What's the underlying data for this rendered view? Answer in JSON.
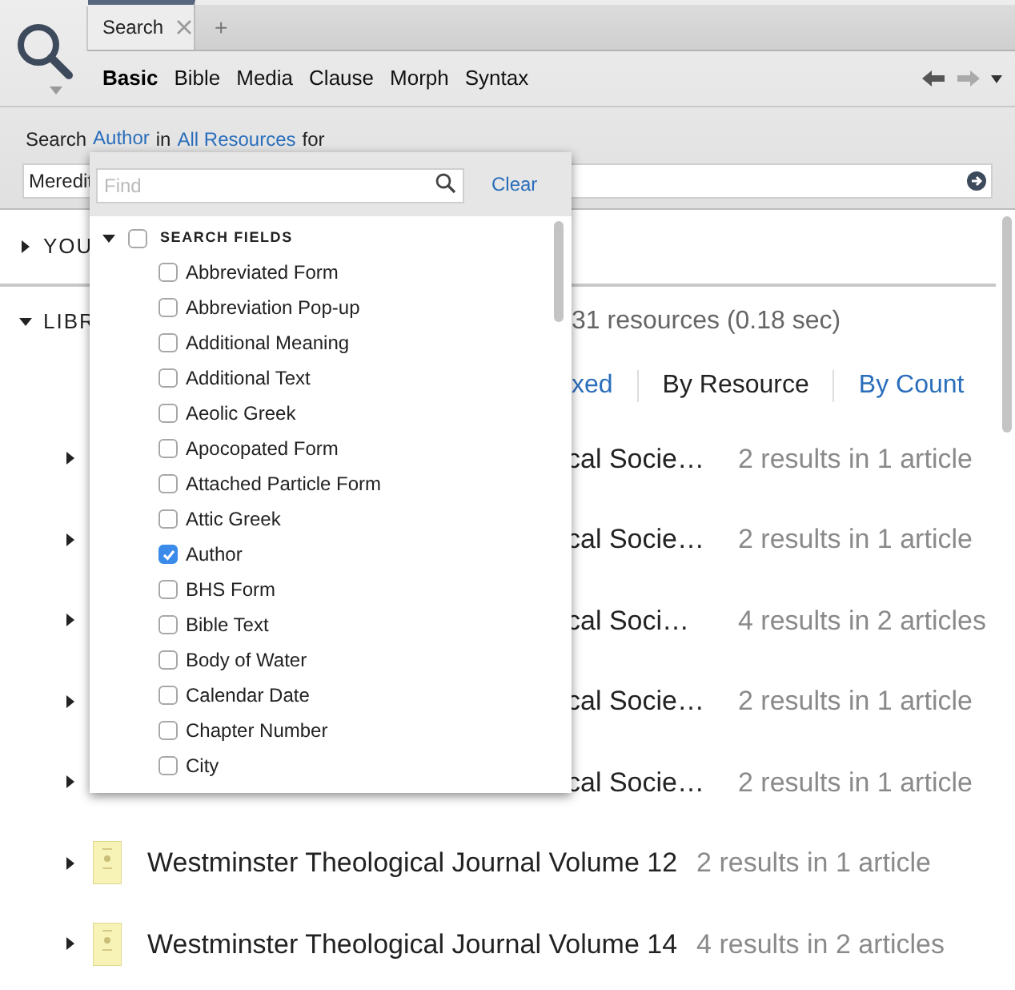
{
  "tabs": [
    {
      "label": "Search",
      "selected": true
    }
  ],
  "new_tab": "+",
  "search_types": [
    {
      "label": "Basic",
      "selected": true
    },
    {
      "label": "Bible",
      "selected": false
    },
    {
      "label": "Media",
      "selected": false
    },
    {
      "label": "Clause",
      "selected": false
    },
    {
      "label": "Morph",
      "selected": false
    },
    {
      "label": "Syntax",
      "selected": false
    }
  ],
  "query": {
    "prefix": "Search",
    "field": "Author",
    "connector": "in",
    "scope": "All Resources",
    "suffix": "for",
    "value": "Meredit"
  },
  "sections": [
    {
      "label": "YOU",
      "expanded": false
    },
    {
      "label": "LIBR",
      "expanded": true
    }
  ],
  "summary": "31 resources (0.18 sec)",
  "view_tabs": [
    {
      "label": "xed",
      "selected": false
    },
    {
      "label": "By Resource",
      "selected": true
    },
    {
      "label": "By Count",
      "selected": false
    }
  ],
  "results": [
    {
      "kind": "covered",
      "title": "cal Socie…",
      "count": "2 results in 1 article"
    },
    {
      "kind": "covered",
      "title": "cal Socie…",
      "count": "2 results in 1 article"
    },
    {
      "kind": "covered",
      "title": "cal Soci…",
      "count": "4 results in 2 articles"
    },
    {
      "kind": "covered",
      "title": "cal Socie…",
      "count": "2 results in 1 article"
    },
    {
      "kind": "covered",
      "title": "cal Socie…",
      "count": "2 results in 1 article"
    },
    {
      "kind": "full",
      "title": "Westminster Theological Journal Volume 12",
      "count": "2 results in 1 article"
    },
    {
      "kind": "full",
      "title": "Westminster Theological Journal Volume 14",
      "count": "4 results in 2 articles"
    }
  ],
  "field_picker": {
    "placeholder": "Find",
    "clear": "Clear",
    "group": {
      "label": "SEARCH FIELDS",
      "expanded": true,
      "checked": false,
      "children": [
        {
          "label": "Abbreviated Form",
          "checked": false
        },
        {
          "label": "Abbreviation Pop-up",
          "checked": false
        },
        {
          "label": "Additional Meaning",
          "checked": false
        },
        {
          "label": "Additional Text",
          "checked": false
        },
        {
          "label": "Aeolic Greek",
          "checked": false
        },
        {
          "label": "Apocopated Form",
          "checked": false
        },
        {
          "label": "Attached Particle Form",
          "checked": false
        },
        {
          "label": "Attic Greek",
          "checked": false
        },
        {
          "label": "Author",
          "checked": true
        },
        {
          "label": "BHS Form",
          "checked": false
        },
        {
          "label": "Bible Text",
          "checked": false
        },
        {
          "label": "Body of Water",
          "checked": false
        },
        {
          "label": "Calendar Date",
          "checked": false
        },
        {
          "label": "Chapter Number",
          "checked": false
        },
        {
          "label": "City",
          "checked": false
        }
      ]
    }
  }
}
